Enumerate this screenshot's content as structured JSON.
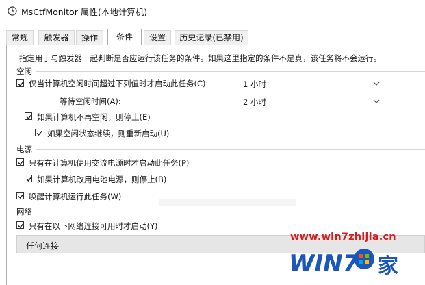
{
  "window": {
    "title": "MsCtfMonitor 属性(本地计算机)"
  },
  "tabs": [
    {
      "label": "常规",
      "active": false
    },
    {
      "label": "触发器",
      "active": false
    },
    {
      "label": "操作",
      "active": false
    },
    {
      "label": "条件",
      "active": true
    },
    {
      "label": "设置",
      "active": false
    },
    {
      "label": "历史记录(已禁用)",
      "active": false
    }
  ],
  "description": "指定用于与触发器一起判断是否应运行该任务的条件。如果这里指定的条件不是真，该任务将不会运行。",
  "idle": {
    "group_label": "空闲",
    "start_if_idle_label": "仅当计算机空闲时间超过下列值时才启动此任务(C):",
    "start_if_idle_checked": true,
    "idle_time_value": "1 小时",
    "wait_label": "等待空闲时间(A):",
    "wait_value": "2 小时",
    "stop_if_not_idle_label": "如果计算机不再空闲，则停止(E)",
    "stop_if_not_idle_checked": true,
    "restart_label": "如果空闲状态继续，则重新启动(U)",
    "restart_checked": true
  },
  "power": {
    "group_label": "电源",
    "ac_only_label": "只有在计算机使用交流电源时才启动此任务(P)",
    "ac_only_checked": true,
    "stop_on_battery_label": "如果计算机改用电池电源，则停止(B)",
    "stop_on_battery_checked": true,
    "wake_label": "唤醒计算机运行此任务(W)",
    "wake_checked": true
  },
  "network": {
    "group_label": "网络",
    "only_if_network_label": "只有在以下网络连接可用时才启动(Y):",
    "only_if_network_checked": true,
    "connection_value": "任何连接"
  },
  "watermark": {
    "url": "www.win7zhijia.cn",
    "logo_text": "WIN7之家",
    "url_color": "#d11f1f",
    "logo_color": "#1b57b8"
  }
}
